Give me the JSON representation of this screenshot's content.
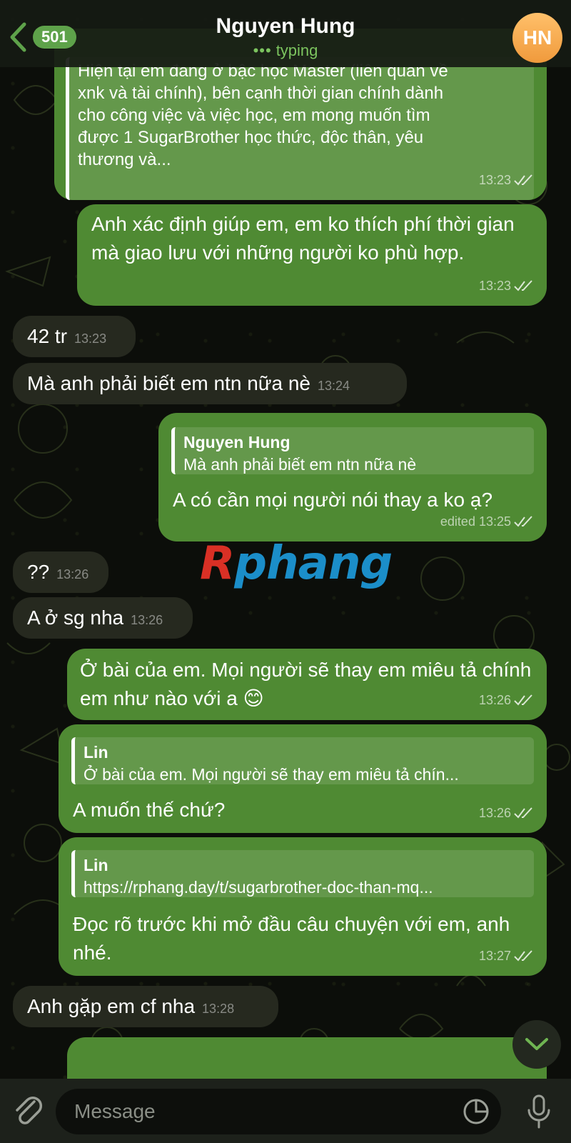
{
  "header": {
    "back_count": "501",
    "title": "Nguyen Hung",
    "status": "typing",
    "avatar_initials": "HN"
  },
  "messages": [
    {
      "id": "m1",
      "direction": "out",
      "lines": [
        "Hiện tại em đang ở bậc học Master (liên quan về",
        "xnk và tài chính), bên cạnh thời gian chính dành",
        "cho công việc và việc học, em mong muốn tìm",
        "được 1 SugarBrother học thức, độc thân, yêu",
        "thương và..."
      ],
      "time": "13:23"
    },
    {
      "id": "m2",
      "direction": "out",
      "text": "Anh xác định giúp em, em ko thích phí thời gian mà giao lưu với những người ko phù hợp.",
      "time": "13:23"
    },
    {
      "id": "m3",
      "direction": "in",
      "text": "42 tr",
      "time": "13:23"
    },
    {
      "id": "m4",
      "direction": "in",
      "text": "Mà anh phải biết em ntn nữa nè",
      "time": "13:24"
    },
    {
      "id": "m5",
      "direction": "out",
      "reply_name": "Nguyen Hung",
      "reply_text": "Mà anh phải biết em ntn nữa nè",
      "text": "A có cần mọi người nói thay a ko ạ?",
      "time": "edited 13:25"
    },
    {
      "id": "m6",
      "direction": "in",
      "text": "??",
      "time": "13:26"
    },
    {
      "id": "m7",
      "direction": "in",
      "text": "A ở sg nha",
      "time": "13:26"
    },
    {
      "id": "m8",
      "direction": "out",
      "text": "Ở bài của em. Mọi người sẽ thay em miêu tả chính em như nào với a 😊",
      "time": "13:26"
    },
    {
      "id": "m9",
      "direction": "out",
      "reply_name": "Lin",
      "reply_text": "Ở bài của em. Mọi người sẽ thay em miêu tả chín...",
      "text": "A muốn thế chứ?",
      "time": "13:26"
    },
    {
      "id": "m10",
      "direction": "out",
      "reply_name": "Lin",
      "reply_text": "https://rphang.day/t/sugarbrother-doc-than-mq...",
      "text": "Đọc rõ trước khi mở đầu câu chuyện với em, anh nhé.",
      "time": "13:27"
    },
    {
      "id": "m11",
      "direction": "in",
      "text": "Anh gặp em cf nha",
      "time": "13:28"
    }
  ],
  "watermark": {
    "part1": "R",
    "part2": "phang"
  },
  "composer": {
    "placeholder": "Message"
  },
  "colors": {
    "outgoing_bubble": "#4f8a33",
    "incoming_bubble": "#26291f",
    "accent": "#5ea24a",
    "avatar": "#f5a94c"
  },
  "icons": [
    "back-chevron-icon",
    "attach-icon",
    "sticker-icon",
    "mic-icon",
    "scroll-down-icon",
    "read-check-icon"
  ]
}
